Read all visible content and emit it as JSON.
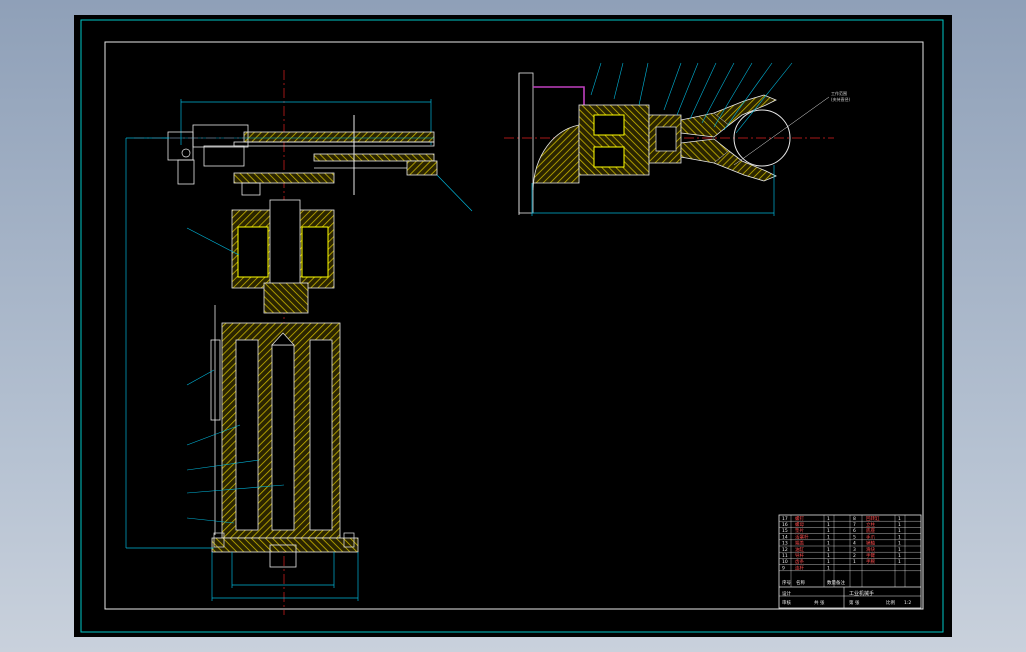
{
  "colors": {
    "background": "#000000",
    "frame": "#00c8c8",
    "border": "#e8e8e8",
    "hatch": "#c8b400",
    "centerline": "#e02020",
    "dimension": "#00b4d8",
    "outline": "#e8e8e8",
    "accent_yellow": "#ffff00",
    "accent_magenta": "#c040c0"
  },
  "drawing": {
    "note": [
      "工作范围",
      "(夹持直径)"
    ]
  },
  "title_block": {
    "parts": [
      {
        "no": "17",
        "name": "螺钉",
        "qty": "1"
      },
      {
        "no": "16",
        "name": "螺母",
        "qty": "1"
      },
      {
        "no": "15",
        "name": "垫片",
        "qty": "1"
      },
      {
        "no": "14",
        "name": "活塞杆",
        "qty": "1"
      },
      {
        "no": "13",
        "name": "端盖",
        "qty": "1"
      },
      {
        "no": "12",
        "name": "油缸",
        "qty": "1"
      },
      {
        "no": "11",
        "name": "导杆",
        "qty": "1"
      },
      {
        "no": "10",
        "name": "齿条",
        "qty": "1"
      },
      {
        "no": "9",
        "name": "连杆",
        "qty": "1"
      },
      {
        "no": "8",
        "name": "回转缸",
        "qty": "1"
      },
      {
        "no": "7",
        "name": "立柱",
        "qty": "1"
      },
      {
        "no": "6",
        "name": "底座",
        "qty": "1"
      },
      {
        "no": "5",
        "name": "手爪",
        "qty": "1"
      },
      {
        "no": "4",
        "name": "销轴",
        "qty": "1"
      },
      {
        "no": "3",
        "name": "滑块",
        "qty": "1"
      },
      {
        "no": "2",
        "name": "手臂",
        "qty": "1"
      },
      {
        "no": "1",
        "name": "手腕",
        "qty": "1"
      }
    ],
    "header": {
      "no": "序号",
      "name": "名称",
      "qty": "数量",
      "remark": "备注"
    },
    "title": "工业机械手",
    "row_a": [
      "设计",
      "",
      "比例",
      "1:2"
    ],
    "row_b": [
      "审核",
      "",
      "共 张",
      "第 张"
    ]
  }
}
